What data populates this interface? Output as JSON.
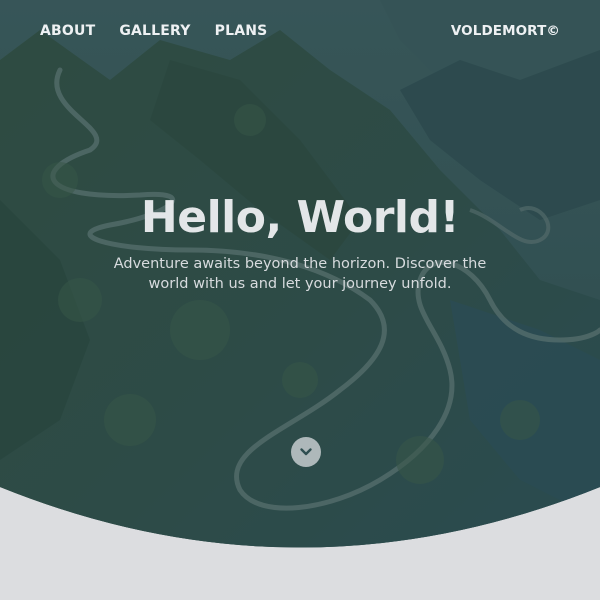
{
  "nav": {
    "links": [
      {
        "label": "ABOUT"
      },
      {
        "label": "GALLERY"
      },
      {
        "label": "PLANS"
      }
    ],
    "brand": "VOLDEMORT©"
  },
  "hero": {
    "title": "Hello, World!",
    "subtitle": "Adventure awaits beyond the horizon. Discover the world with us and let your journey unfold.",
    "scroll_icon": "chevron-down-icon"
  },
  "colors": {
    "overlay": "#2c4d4f",
    "page_background": "#dcdde0",
    "text": "#eef1f3"
  }
}
